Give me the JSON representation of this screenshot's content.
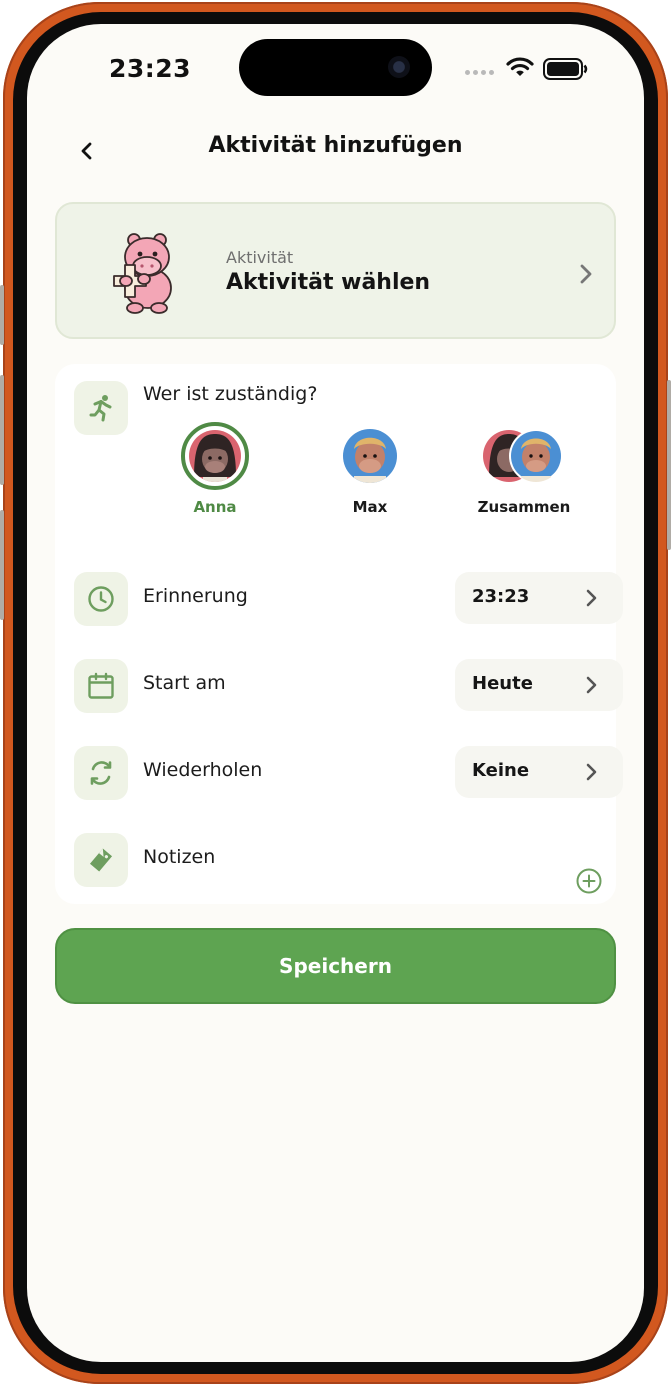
{
  "status_bar": {
    "time": "23:23"
  },
  "header": {
    "title": "Aktivität hinzufügen"
  },
  "activity": {
    "caption": "Aktivität",
    "value": "Aktivität wählen"
  },
  "responsible": {
    "label": "Wer ist zuständig?",
    "options": [
      {
        "name": "Anna",
        "selected": true
      },
      {
        "name": "Max",
        "selected": false
      },
      {
        "name": "Zusammen",
        "selected": false
      }
    ]
  },
  "rows": {
    "reminder": {
      "label": "Erinnerung",
      "value": "23:23"
    },
    "start": {
      "label": "Start am",
      "value": "Heute"
    },
    "repeat": {
      "label": "Wiederholen",
      "value": "Keine"
    },
    "notes": {
      "label": "Notizen"
    }
  },
  "save_button": "Speichern",
  "colors": {
    "accent": "#5ea451",
    "selected_text": "#4f8a45",
    "icon_green": "#6e9e5f",
    "frame": "#d2581f",
    "background": "#fcfbf7"
  },
  "icons": {
    "back": "chevron-left-icon",
    "activity_mascot": "pink-hippo-icon",
    "responsible": "running-person-icon",
    "reminder": "clock-icon",
    "start": "calendar-icon",
    "repeat": "repeat-icon",
    "notes": "tag-icon",
    "add": "plus-circle-icon"
  }
}
